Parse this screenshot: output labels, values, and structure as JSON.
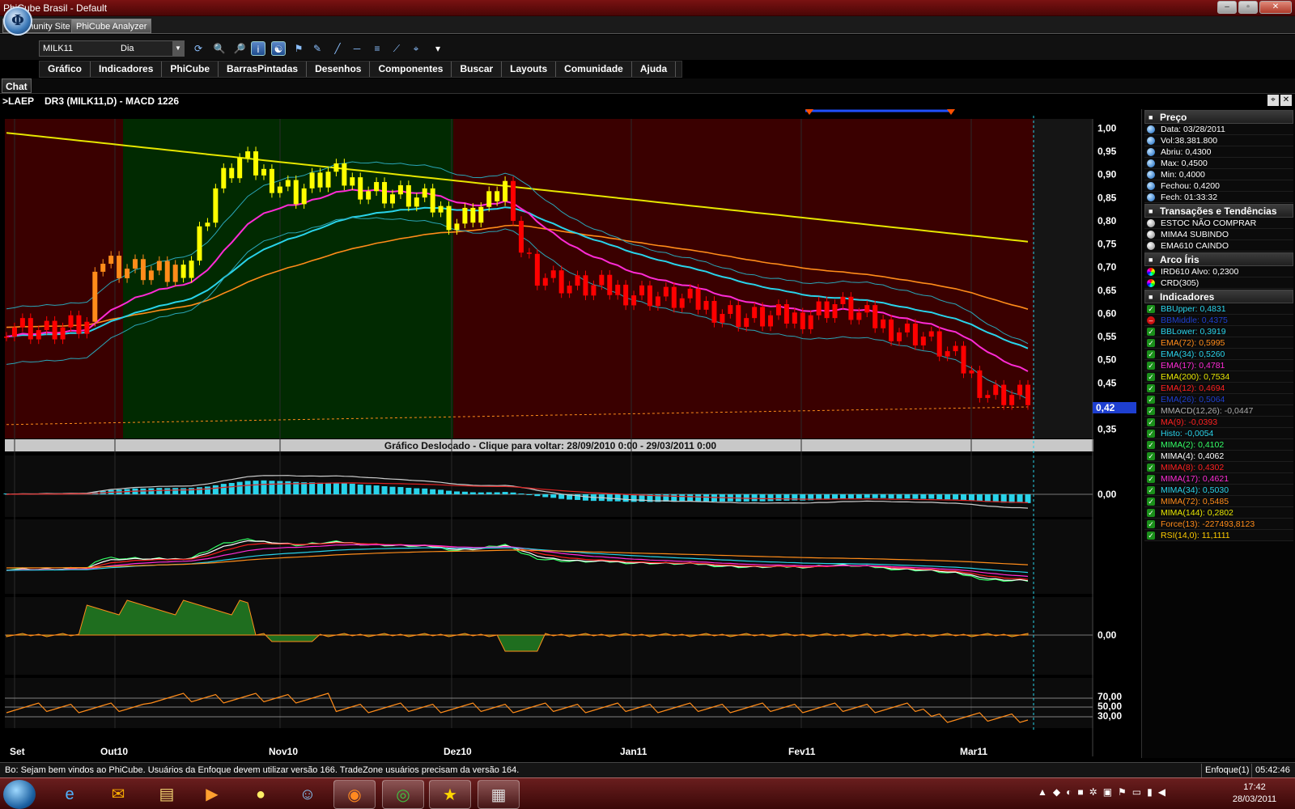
{
  "window": {
    "title": "PhiCube Brasil - Default",
    "min_icon": "minimize-icon",
    "max_icon": "maximize-icon",
    "close_icon": "close-icon"
  },
  "tabs": [
    "Community Site",
    "PhiCube Analyzer"
  ],
  "toolbar": {
    "symbol": "MILK11",
    "period": "Dia"
  },
  "menu": [
    "Gráfico",
    "Indicadores",
    "PhiCube",
    "BarrasPintadas",
    "Desenhos",
    "Componentes",
    "Buscar",
    "Layouts",
    "Comunidade",
    "Ajuda"
  ],
  "chat_label": "Chat",
  "chart_header": {
    "prefix": ">LAEP",
    "title": "DR3 (MILK11,D) - MACD 1226"
  },
  "shift_banner": "Gráfico Deslocado - Clique para voltar: 28/09/2010 0:00 - 29/03/2011 0:00",
  "chart_data": {
    "type": "candlestick",
    "price_axis": [
      "1,00",
      "0,95",
      "0,90",
      "0,85",
      "0,80",
      "0,75",
      "0,70",
      "0,65",
      "0,60",
      "0,55",
      "0,50",
      "0,45",
      "0,40",
      "0,35"
    ],
    "price_range": [
      0.33,
      1.02
    ],
    "current_price_label": "0,42",
    "x_labels": [
      "Set",
      "Out10",
      "Nov10",
      "Dez10",
      "Jan11",
      "Fev11",
      "Mar11"
    ],
    "macd_axis": [
      "0,00"
    ],
    "force_axis": [
      "0,00"
    ],
    "rsi_axis": [
      "70,00",
      "50,00",
      "30,00"
    ],
    "colors": {
      "bull": "#ffff00",
      "bear": "#ff0000",
      "orange": "#ff8c1a",
      "ema34": "#29d3ea",
      "ema17": "#ff2bd6",
      "ema200": "#e6e600",
      "ema72": "#ff8c1a",
      "bg_red": "#3a0000",
      "bg_green": "#012a01"
    }
  },
  "panel": {
    "preco_title": "Preço",
    "preco": [
      "Data: 03/28/2011",
      "Vol:38.381.800",
      "Abriu: 0,4300",
      "Max: 0,4500",
      "Min: 0,4000",
      "Fechou: 0,4200",
      "Fech: 01:33:32"
    ],
    "trans_title": "Transações e Tendências",
    "trans": [
      "ESTOC NÃO COMPRAR",
      "MIMA4 SUBINDO",
      "EMA610 CAINDO"
    ],
    "arco_title": "Arco Íris",
    "arco": [
      "IRD610 Alvo: 0,2300",
      "CRD(305)"
    ],
    "ind_title": "Indicadores",
    "indicators": [
      {
        "text": "BBUpper: 0,4831",
        "color": "#29d3ea",
        "icon": "check"
      },
      {
        "text": "BBMiddle: 0,4375",
        "color": "#1e3fd0",
        "icon": "stop"
      },
      {
        "text": "BBLower: 0,3919",
        "color": "#29d3ea",
        "icon": "check"
      },
      {
        "text": "EMA(72): 0,5995",
        "color": "#ff8c1a",
        "icon": "check"
      },
      {
        "text": "EMA(34): 0,5260",
        "color": "#29d3ea",
        "icon": "check"
      },
      {
        "text": "EMA(17): 0,4781",
        "color": "#ff2bd6",
        "icon": "check"
      },
      {
        "text": "EMA(200): 0,7534",
        "color": "#e6e600",
        "icon": "check"
      },
      {
        "text": "EMA(12): 0,4694",
        "color": "#ff2020",
        "icon": "check"
      },
      {
        "text": "EMA(26): 0,5064",
        "color": "#1e3fd0",
        "icon": "check"
      },
      {
        "text": "MMACD(12,26): -0,0447",
        "color": "#aaaaaa",
        "icon": "check"
      },
      {
        "text": "MA(9): -0,0393",
        "color": "#ff2020",
        "icon": "check"
      },
      {
        "text": "Histo: -0,0054",
        "color": "#29d3ea",
        "icon": "check"
      },
      {
        "text": "MIMA(2): 0,4102",
        "color": "#33ff66",
        "icon": "check"
      },
      {
        "text": "MIMA(4): 0,4062",
        "color": "#ffffff",
        "icon": "check"
      },
      {
        "text": "MIMA(8): 0,4302",
        "color": "#ff2020",
        "icon": "check"
      },
      {
        "text": "MIMA(17): 0,4621",
        "color": "#ff2bd6",
        "icon": "check"
      },
      {
        "text": "MIMA(34): 0,5030",
        "color": "#29d3ea",
        "icon": "check"
      },
      {
        "text": "MIMA(72): 0,5485",
        "color": "#ff8c1a",
        "icon": "check"
      },
      {
        "text": "MIMA(144): 0,2802",
        "color": "#e6e600",
        "icon": "check"
      },
      {
        "text": "Force(13): -227493,8123",
        "color": "#ff8c1a",
        "icon": "check"
      },
      {
        "text": "RSI(14,0): 11,1111",
        "color": "#ffcc00",
        "icon": "check"
      }
    ]
  },
  "status": {
    "message": "Bo: Sejam bem vindos ao PhiCube.  Usuários da Enfoque devem utilizar versão 166.  TradeZone usuários precisam da versão 164.",
    "enfoque": "Enfoque(1)",
    "time": "05:42:46"
  },
  "taskbar": {
    "items": [
      "ie-icon",
      "outlook-icon",
      "folder-icon",
      "media-icon",
      "lightbulb-icon",
      "people-icon",
      "firefox-icon",
      "chrome-icon",
      "star-icon",
      "app-icon"
    ],
    "clock_time": "17:42",
    "clock_date": "28/03/2011"
  }
}
